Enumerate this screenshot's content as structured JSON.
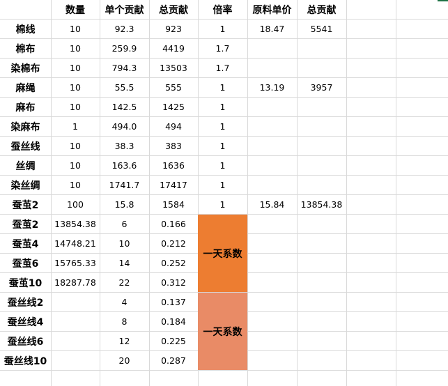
{
  "headers": [
    "",
    "数量",
    "单个贡献",
    "总贡献",
    "倍率",
    "原料单价",
    "总贡献"
  ],
  "rows": [
    [
      "棉线",
      "10",
      "92.3",
      "923",
      "1",
      "18.47",
      "5541"
    ],
    [
      "棉布",
      "10",
      "259.9",
      "4419",
      "1.7",
      "",
      ""
    ],
    [
      "染棉布",
      "10",
      "794.3",
      "13503",
      "1.7",
      "",
      ""
    ],
    [
      "麻绳",
      "10",
      "55.5",
      "555",
      "1",
      "13.19",
      "3957"
    ],
    [
      "麻布",
      "10",
      "142.5",
      "1425",
      "1",
      "",
      ""
    ],
    [
      "染麻布",
      "1",
      "494.0",
      "494",
      "1",
      "",
      ""
    ],
    [
      "蚕丝线",
      "10",
      "38.3",
      "383",
      "1",
      "",
      ""
    ],
    [
      "丝绸",
      "10",
      "163.6",
      "1636",
      "1",
      "",
      ""
    ],
    [
      "染丝绸",
      "10",
      "1741.7",
      "17417",
      "1",
      "",
      ""
    ],
    [
      "蚕茧2",
      "100",
      "15.8",
      "1584",
      "1",
      "15.84",
      "13854.38"
    ],
    [
      "蚕茧2",
      "13854.38",
      "6",
      "0.166",
      "",
      "",
      ""
    ],
    [
      "蚕茧4",
      "14748.21",
      "10",
      "0.212",
      "",
      "",
      ""
    ],
    [
      "蚕茧6",
      "15765.33",
      "14",
      "0.252",
      "",
      "",
      ""
    ],
    [
      "蚕茧10",
      "18287.78",
      "22",
      "0.312",
      "",
      "",
      ""
    ],
    [
      "蚕丝线2",
      "",
      "4",
      "0.137",
      "",
      "",
      ""
    ],
    [
      "蚕丝线4",
      "",
      "8",
      "0.184",
      "",
      "",
      ""
    ],
    [
      "蚕丝线6",
      "",
      "12",
      "0.225",
      "",
      "",
      ""
    ],
    [
      "蚕丝线10",
      "",
      "20",
      "0.287",
      "",
      "",
      ""
    ]
  ],
  "merged_labels": {
    "top": "一天系数",
    "bottom": "一天系数"
  },
  "colors": {
    "merged_top": "#ed7d31",
    "merged_bottom": "#e98b66",
    "gridline": "#d9d9d9"
  }
}
